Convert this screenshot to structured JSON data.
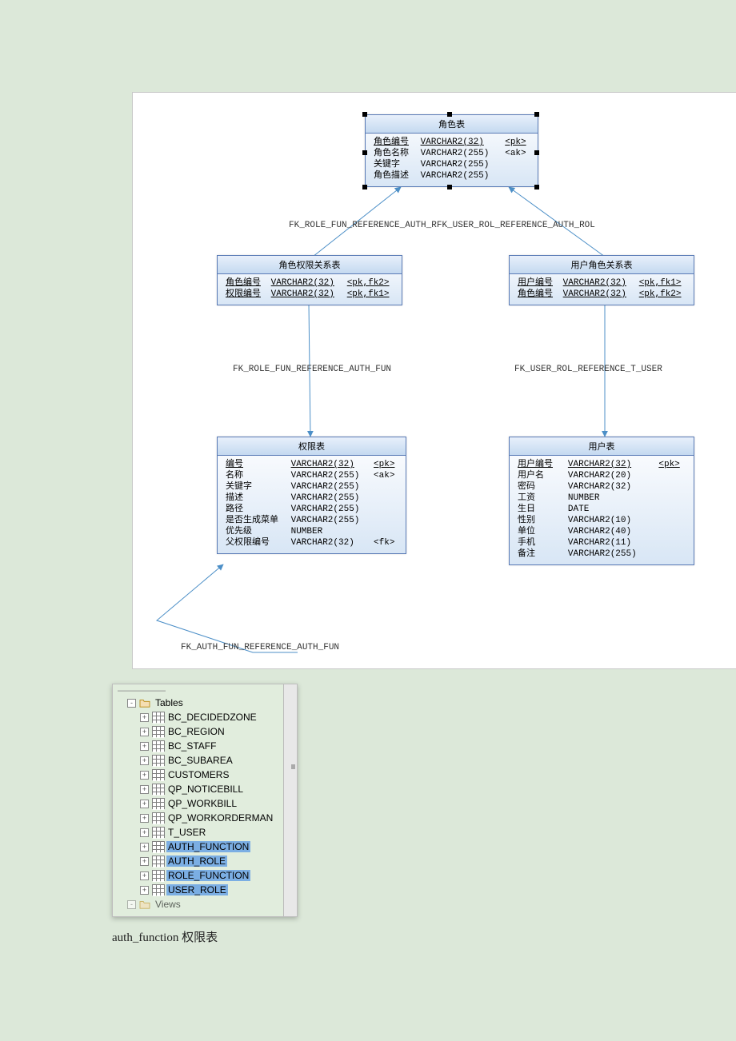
{
  "diagram": {
    "entities": {
      "role": {
        "title": "角色表",
        "rows": [
          {
            "name": "角色编号",
            "type": "VARCHAR2(32)",
            "key": "<pk>",
            "u": true
          },
          {
            "name": "角色名称",
            "type": "VARCHAR2(255)",
            "key": "<ak>",
            "u": false
          },
          {
            "name": "关键字",
            "type": "VARCHAR2(255)",
            "key": "",
            "u": false
          },
          {
            "name": "角色描述",
            "type": "VARCHAR2(255)",
            "key": "",
            "u": false
          }
        ]
      },
      "role_fun": {
        "title": "角色权限关系表",
        "rows": [
          {
            "name": "角色编号",
            "type": "VARCHAR2(32)",
            "key": "<pk,fk2>",
            "u": true
          },
          {
            "name": "权限编号",
            "type": "VARCHAR2(32)",
            "key": "<pk,fk1>",
            "u": true
          }
        ]
      },
      "user_role": {
        "title": "用户角色关系表",
        "rows": [
          {
            "name": "用户编号",
            "type": "VARCHAR2(32)",
            "key": "<pk,fk1>",
            "u": true
          },
          {
            "name": "角色编号",
            "type": "VARCHAR2(32)",
            "key": "<pk,fk2>",
            "u": true
          }
        ]
      },
      "function": {
        "title": "权限表",
        "rows": [
          {
            "name": "编号",
            "type": "VARCHAR2(32)",
            "key": "<pk>",
            "u": true
          },
          {
            "name": "名称",
            "type": "VARCHAR2(255)",
            "key": "<ak>",
            "u": false
          },
          {
            "name": "关键字",
            "type": "VARCHAR2(255)",
            "key": "",
            "u": false
          },
          {
            "name": "描述",
            "type": "VARCHAR2(255)",
            "key": "",
            "u": false
          },
          {
            "name": "路径",
            "type": "VARCHAR2(255)",
            "key": "",
            "u": false
          },
          {
            "name": "是否生成菜单",
            "type": "VARCHAR2(255)",
            "key": "",
            "u": false
          },
          {
            "name": "优先级",
            "type": "NUMBER",
            "key": "",
            "u": false
          },
          {
            "name": "父权限编号",
            "type": "VARCHAR2(32)",
            "key": "<fk>",
            "u": false
          }
        ]
      },
      "user": {
        "title": "用户表",
        "rows": [
          {
            "name": "用户编号",
            "type": "VARCHAR2(32)",
            "key": "<pk>",
            "u": true
          },
          {
            "name": "用户名",
            "type": "VARCHAR2(20)",
            "key": "",
            "u": false
          },
          {
            "name": "密码",
            "type": "VARCHAR2(32)",
            "key": "",
            "u": false
          },
          {
            "name": "工资",
            "type": "NUMBER",
            "key": "",
            "u": false
          },
          {
            "name": "生日",
            "type": "DATE",
            "key": "",
            "u": false
          },
          {
            "name": "性别",
            "type": "VARCHAR2(10)",
            "key": "",
            "u": false
          },
          {
            "name": "单位",
            "type": "VARCHAR2(40)",
            "key": "",
            "u": false
          },
          {
            "name": "手机",
            "type": "VARCHAR2(11)",
            "key": "",
            "u": false
          },
          {
            "name": "备注",
            "type": "VARCHAR2(255)",
            "key": "",
            "u": false
          }
        ]
      }
    },
    "fk_labels": {
      "top_left": "FK_ROLE_FUN_REFERENCE_AUTH_R",
      "top_right": "FK_USER_ROL_REFERENCE_AUTH_ROL",
      "mid_left": "FK_ROLE_FUN_REFERENCE_AUTH_FUN",
      "mid_right": "FK_USER_ROL_REFERENCE_T_USER",
      "bottom": "FK_AUTH_FUN_REFERENCE_AUTH_FUN"
    }
  },
  "tree": {
    "root": "Tables",
    "items": [
      {
        "label": "BC_DECIDEDZONE",
        "sel": false
      },
      {
        "label": "BC_REGION",
        "sel": false
      },
      {
        "label": "BC_STAFF",
        "sel": false
      },
      {
        "label": "BC_SUBAREA",
        "sel": false
      },
      {
        "label": "CUSTOMERS",
        "sel": false
      },
      {
        "label": "QP_NOTICEBILL",
        "sel": false
      },
      {
        "label": "QP_WORKBILL",
        "sel": false
      },
      {
        "label": "QP_WORKORDERMAN",
        "sel": false
      },
      {
        "label": "T_USER",
        "sel": false
      },
      {
        "label": "AUTH_FUNCTION",
        "sel": true
      },
      {
        "label": "AUTH_ROLE",
        "sel": true
      },
      {
        "label": "ROLE_FUNCTION",
        "sel": true
      },
      {
        "label": "USER_ROLE",
        "sel": true
      }
    ],
    "cut_bottom": "Views"
  },
  "caption": "auth_function  权限表"
}
